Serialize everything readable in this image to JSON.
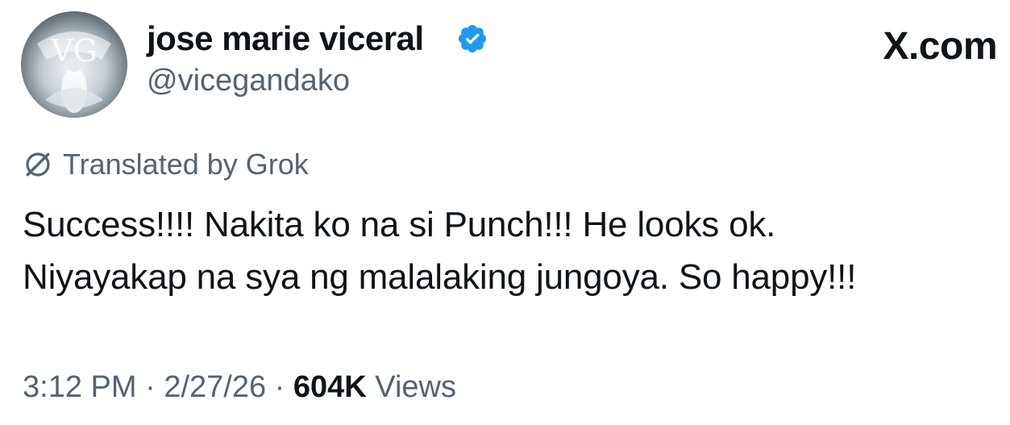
{
  "author": {
    "display_name": "jose marie viceral",
    "handle": "@vicegandako",
    "avatar_icon": "profile-avatar",
    "verified_icon": "verified-badge-icon",
    "verified_color": "#1d9bf0"
  },
  "brand": {
    "label": "X.com"
  },
  "translation": {
    "label": "Translated by Grok",
    "icon": "grok-icon"
  },
  "tweet": {
    "text": "Success!!!! Nakita ko na si Punch!!! He looks ok.\nNiyayakap na sya ng malalaking jungoya. So happy!!!"
  },
  "meta": {
    "time": "3:12 PM",
    "separator": " · ",
    "date": "2/27/26",
    "views_count": "604K",
    "views_label": "Views"
  },
  "colors": {
    "text_primary": "#0f1419",
    "text_secondary": "#536471",
    "accent": "#1d9bf0"
  }
}
